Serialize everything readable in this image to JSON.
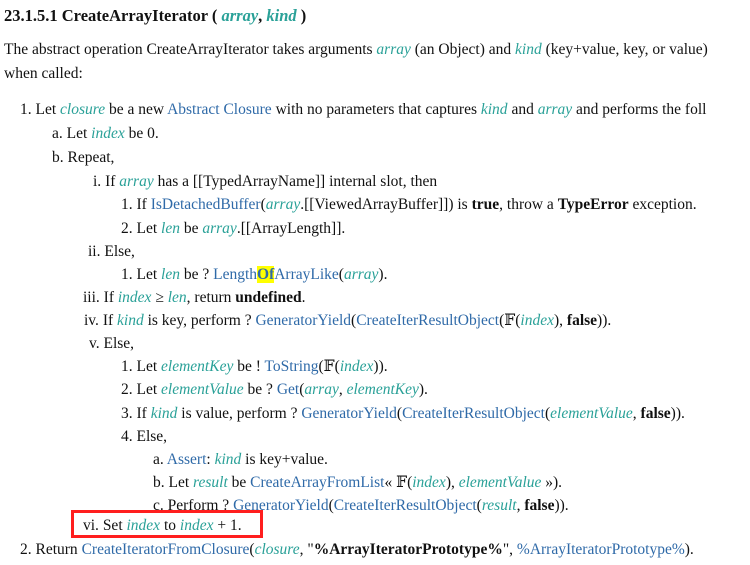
{
  "heading": {
    "number": "23.1.5.1",
    "name": "CreateArrayIterator",
    "open": " (",
    "arg1": "array",
    "comma": ", ",
    "arg2": "kind",
    "close": " )"
  },
  "intro": {
    "l1_a": "The abstract operation CreateArrayIterator takes arguments ",
    "l1_b": "array",
    "l1_c": " (an Object) and ",
    "l1_d": "kind",
    "l1_e": " (key+value, key, or value)",
    "l2": "when called:"
  },
  "steps": {
    "s1": {
      "m": "1.",
      "t1": "Let ",
      "v1": "closure",
      "t2": " be a new ",
      "l1": "Abstract Closure",
      "t3": " with no parameters that captures ",
      "v2": "kind",
      "t4": " and ",
      "v3": "array",
      "t5": " and performs the foll"
    },
    "s1a": {
      "m": "a.",
      "t1": "Let ",
      "v1": "index",
      "t2": " be 0."
    },
    "s1b": {
      "m": "b.",
      "t1": "Repeat,"
    },
    "s1bi": {
      "m": "i.",
      "t1": "If ",
      "v1": "array",
      "t2": " has a [[TypedArrayName]] internal slot, then"
    },
    "s1bi1": {
      "m": "1.",
      "t1": "If ",
      "l1": "IsDetachedBuffer",
      "t2": "(",
      "v1": "array",
      "t3": ".[[ViewedArrayBuffer]]) is ",
      "b1": "true",
      "t4": ", throw a ",
      "b2": "TypeError",
      "t5": " exception."
    },
    "s1bi2": {
      "m": "2.",
      "t1": "Let ",
      "v1": "len",
      "t2": " be ",
      "v2": "array",
      "t3": ".[[ArrayLength]]."
    },
    "s1bii": {
      "m": "ii.",
      "t1": "Else,"
    },
    "s1bii1": {
      "m": "1.",
      "t1": "Let ",
      "v1": "len",
      "t2": " be ? ",
      "l1": "Length",
      "h1": "Of",
      "l2": "ArrayLike",
      "t3": "(",
      "v2": "array",
      "t4": ")."
    },
    "s1biii": {
      "m": "iii.",
      "t1": "If ",
      "v1": "index",
      "t2": " ≥ ",
      "v2": "len",
      "t3": ", return ",
      "b1": "undefined",
      "t4": "."
    },
    "s1biv": {
      "m": "iv.",
      "t1": "If ",
      "v1": "kind",
      "t2": " is key, perform ? ",
      "l1": "GeneratorYield",
      "t3": "(",
      "l2": "CreateIterResultObject",
      "t4": "(𝔽(",
      "v2": "index",
      "t5": "), ",
      "b1": "false",
      "t6": "))."
    },
    "s1bv": {
      "m": "v.",
      "t1": "Else,"
    },
    "s1bv1": {
      "m": "1.",
      "t1": "Let ",
      "v1": "elementKey",
      "t2": " be ! ",
      "l1": "ToString",
      "t3": "(𝔽(",
      "v2": "index",
      "t4": "))."
    },
    "s1bv2": {
      "m": "2.",
      "t1": "Let ",
      "v1": "elementValue",
      "t2": " be ? ",
      "l1": "Get",
      "t3": "(",
      "v2": "array",
      "t4": ", ",
      "v3": "elementKey",
      "t5": ")."
    },
    "s1bv3": {
      "m": "3.",
      "t1": "If ",
      "v1": "kind",
      "t2": " is value, perform ? ",
      "l1": "GeneratorYield",
      "t3": "(",
      "l2": "CreateIterResultObject",
      "t4": "(",
      "v2": "elementValue",
      "t5": ", ",
      "b1": "false",
      "t6": "))."
    },
    "s1bv4": {
      "m": "4.",
      "t1": "Else,"
    },
    "s1bv4a": {
      "m": "a.",
      "l1": "Assert",
      "t1": ": ",
      "v1": "kind",
      "t2": " is key+value."
    },
    "s1bv4b": {
      "m": "b.",
      "t1": "Let ",
      "v1": "result",
      "t2": " be ",
      "l1": "CreateArrayFromList",
      "t3": "« 𝔽(",
      "v2": "index",
      "t4": "), ",
      "v3": "elementValue",
      "t5": " »)."
    },
    "s1bv4c": {
      "m": "c.",
      "t1": "Perform ? ",
      "l1": "GeneratorYield",
      "t2": "(",
      "l2": "CreateIterResultObject",
      "t3": "(",
      "v1": "result",
      "t4": ", ",
      "b1": "false",
      "t5": "))."
    },
    "s1bvi": {
      "m": "vi.",
      "t1": "Set ",
      "v1": "index",
      "t2": " to ",
      "v2": "index",
      "t3": " + 1."
    },
    "s2": {
      "m": "2.",
      "t1": "Return ",
      "l1": "CreateIteratorFromClosure",
      "t2": "(",
      "v1": "closure",
      "t3": ", \"",
      "b1": "%ArrayIteratorPrototype%",
      "t4": "\", ",
      "l2": "%ArrayIteratorPrototype%",
      "t5": ")."
    }
  },
  "colors": {
    "variable": "#2aa198",
    "link": "#2f6aa8",
    "highlight": "#ffff00",
    "callout_box": "#ff1e1e"
  }
}
